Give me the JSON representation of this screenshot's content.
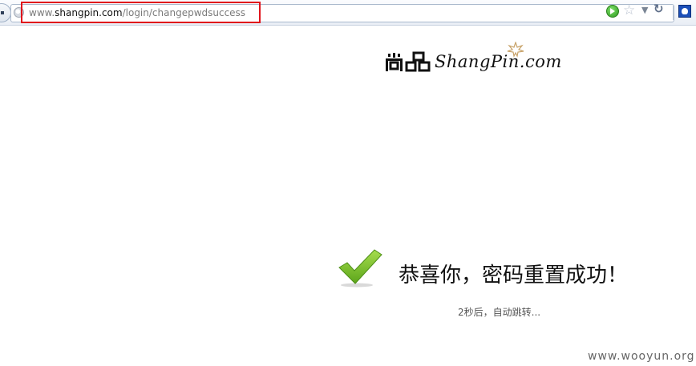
{
  "browser": {
    "url_prefix": "www.",
    "url_domain": "shangpin.com",
    "url_path": "/login/changepwdsuccess",
    "icons": {
      "site": "globe-icon",
      "go": "go-arrow-icon",
      "bookmark": "star-icon",
      "history": "chevron-down-icon",
      "reload": "reload-icon",
      "search_engine": "paw-icon"
    },
    "highlight_color": "#e0141c"
  },
  "logo": {
    "brand_text": "ShangPin.com",
    "glyph_text": "尚品"
  },
  "main": {
    "success_message": "恭喜你，密码重置成功！",
    "redirect_note": "2秒后，自动跳转..."
  },
  "watermark": "www.wooyun.org",
  "colors": {
    "check_green": "#7cc02a"
  }
}
